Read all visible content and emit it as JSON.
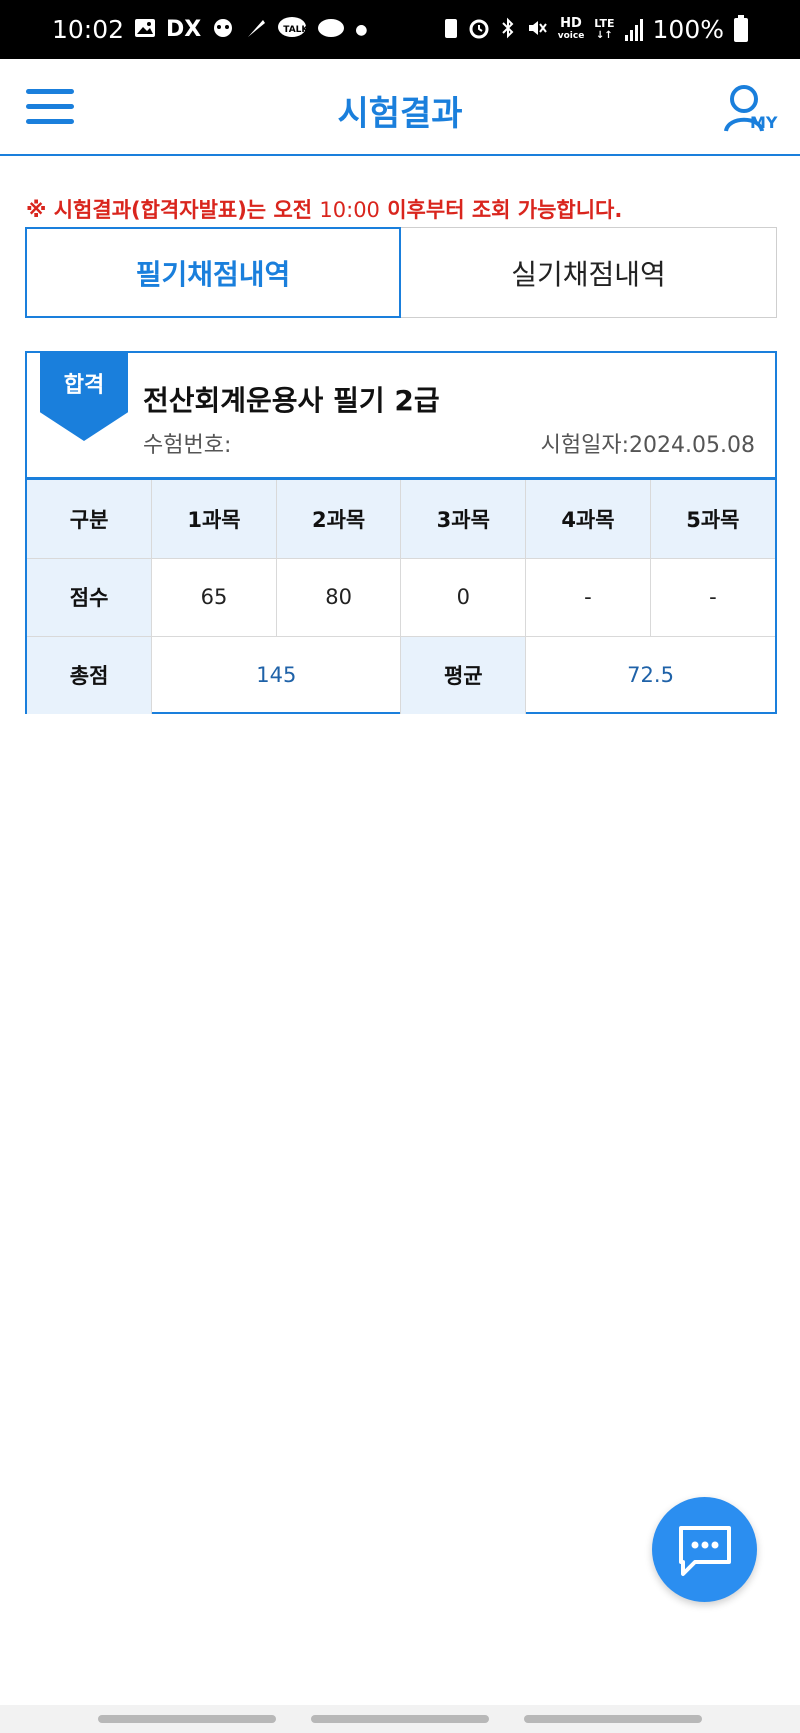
{
  "status_bar": {
    "time": "10:02",
    "left_icons": [
      "gallery-icon",
      "dx-icon",
      "robot-icon",
      "feather-icon",
      "talk-icon",
      "cloud-icon",
      "dot-icon"
    ],
    "right_icons": [
      "battery-saver-icon",
      "alarm-icon",
      "bluetooth-icon",
      "mute-icon",
      "hd-voice-icon",
      "lte-icon",
      "signal-icon"
    ],
    "dx_label": "DX",
    "talk_label": "TALK",
    "hd_label": "HD",
    "voice_label": "voice",
    "lte_label": "LTE",
    "battery": "100%"
  },
  "header": {
    "title": "시험결과",
    "menu_icon": "hamburger-menu-icon",
    "my_icon": "user-my-icon",
    "my_label": "MY"
  },
  "notice": {
    "mark": "※",
    "text_before": " 시험결과(합격자발표)는 오전 ",
    "time": "10:00",
    "text_after": " 이후부터 조회 가능합니다."
  },
  "tabs": [
    {
      "label": "필기채점내역",
      "active": true
    },
    {
      "label": "실기채점내역",
      "active": false
    }
  ],
  "result_card": {
    "badge": "합격",
    "exam_name": "전산회계운용사 필기 2급",
    "exam_number_label": "수험번호:",
    "exam_number": "",
    "exam_date_label": "시험일자:",
    "exam_date": "2024.05.08",
    "table": {
      "header_label": "구분",
      "subjects": [
        "1과목",
        "2과목",
        "3과목",
        "4과목",
        "5과목"
      ],
      "score_label": "점수",
      "scores": [
        "65",
        "80",
        "0",
        "-",
        "-"
      ],
      "total_label": "총점",
      "total": "145",
      "average_label": "평균",
      "average": "72.5"
    }
  },
  "chat_button": {
    "icon": "chat-bubble-icon"
  },
  "colors": {
    "accent": "#1a7fdc",
    "notice": "#d9251d",
    "header_cell": "#e8f2fc",
    "fab": "#2b8ef0"
  }
}
